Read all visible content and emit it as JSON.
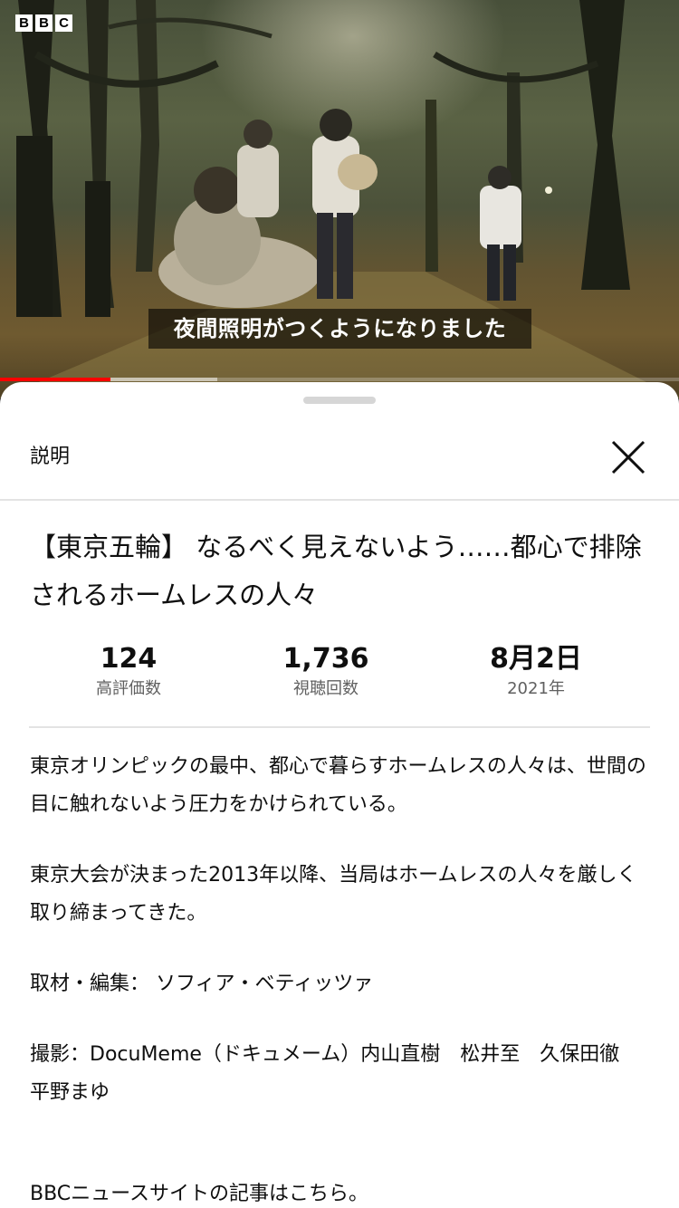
{
  "video": {
    "channel_logo": [
      "B",
      "B",
      "C"
    ],
    "caption": "夜間照明がつくようになりました",
    "progress_played": 0.163,
    "progress_buffered": 0.32
  },
  "sheet": {
    "header_title": "説明",
    "close_icon": "close-icon",
    "video_title": "【東京五輪】 なるべく見えないよう……都心で排除されるホームレスの人々",
    "stats": [
      {
        "value": "124",
        "label": "高評価数"
      },
      {
        "value": "1,736",
        "label": "視聴回数"
      },
      {
        "value": "8月2日",
        "label": "2021年"
      }
    ],
    "description": [
      "東京オリンピックの最中、都心で暮らすホームレスの人々は、世間の目に触れないよう圧力をかけられている。",
      "東京大会が決まった2013年以降、当局はホームレスの人々を厳しく取り締まってきた。",
      "取材・編集： ソフィア・ベティッツァ",
      "撮影：DocuMeme（ドキュメーム）内山直樹　松井至　久保田徹　平野まゆ",
      "BBCニュースサイトの記事はこちら。"
    ]
  },
  "colors": {
    "progress_played": "#ff0000",
    "text_primary": "#0f0f0f",
    "text_secondary": "#606060",
    "divider": "#e3e3e3"
  }
}
